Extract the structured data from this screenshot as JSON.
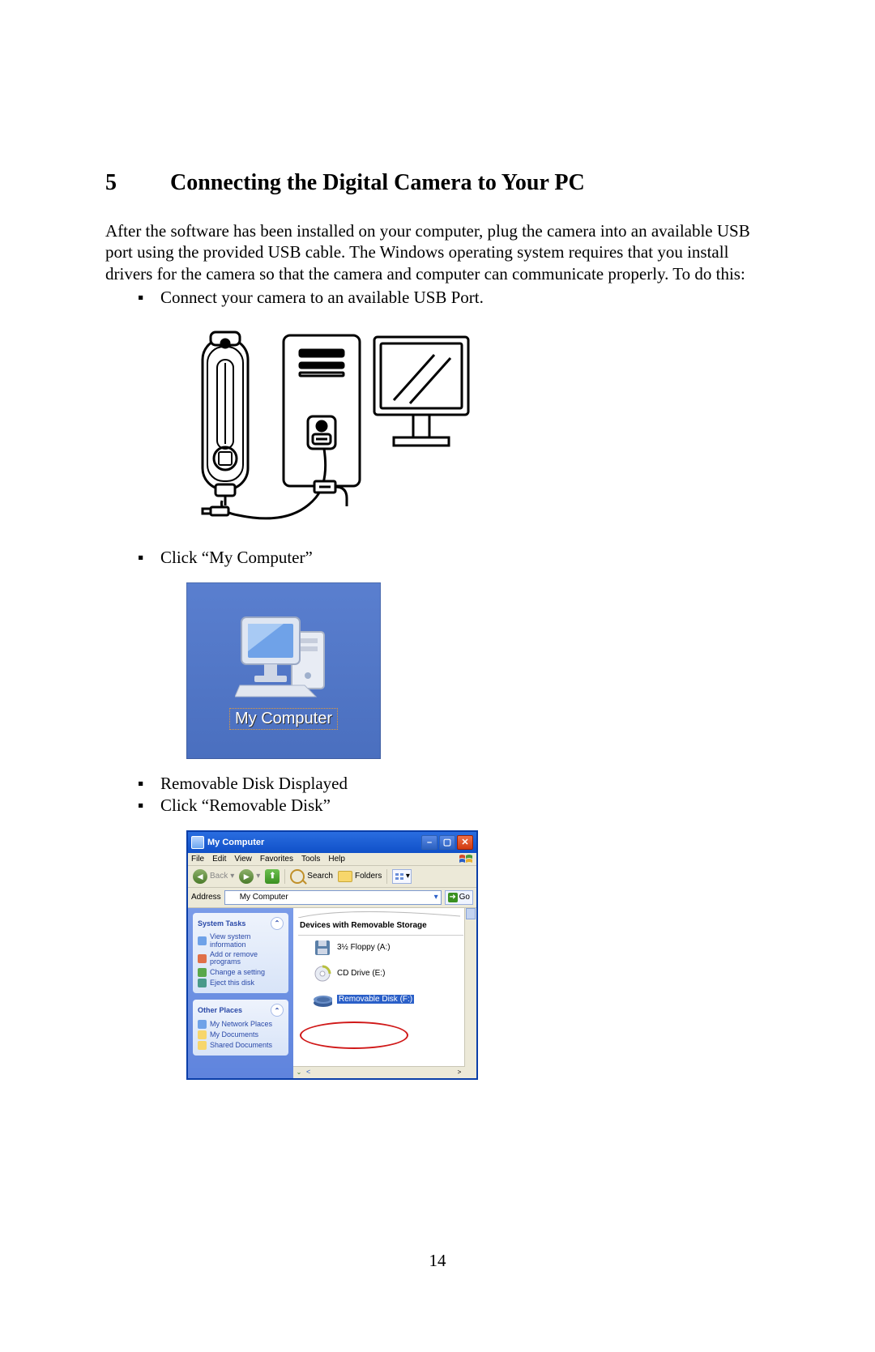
{
  "heading": {
    "number": "5",
    "title": "Connecting the Digital Camera to Your PC"
  },
  "intro": "After the software has been installed on your computer, plug the camera into an available USB port using the provided USB cable.  The Windows operating system requires that you install drivers for the camera so that the camera and computer can communicate properly. To do this:",
  "bullets": {
    "b1": "Connect your camera to an available USB Port.",
    "b2": "Click “My Computer”",
    "b3": "Removable Disk Displayed",
    "b4": "Click “Removable Disk”"
  },
  "desktop_icon": {
    "label": "My Computer"
  },
  "explorer": {
    "title": "My Computer",
    "menu": {
      "file": "File",
      "edit": "Edit",
      "view": "View",
      "favorites": "Favorites",
      "tools": "Tools",
      "help": "Help"
    },
    "toolbar": {
      "back": "Back",
      "search": "Search",
      "folders": "Folders"
    },
    "address": {
      "label": "Address",
      "value": "My Computer",
      "go": "Go"
    },
    "sidebar": {
      "system_tasks": {
        "header": "System Tasks",
        "view_info": "View system information",
        "add_remove": "Add or remove programs",
        "change_setting": "Change a setting",
        "eject": "Eject this disk"
      },
      "other_places": {
        "header": "Other Places",
        "network": "My Network Places",
        "documents": "My Documents",
        "shared": "Shared Documents"
      }
    },
    "main": {
      "section": "Devices with Removable Storage",
      "floppy": "3½ Floppy (A:)",
      "cd": "CD Drive (E:)",
      "removable": "Removable Disk (F:)"
    }
  },
  "page_number": "14"
}
